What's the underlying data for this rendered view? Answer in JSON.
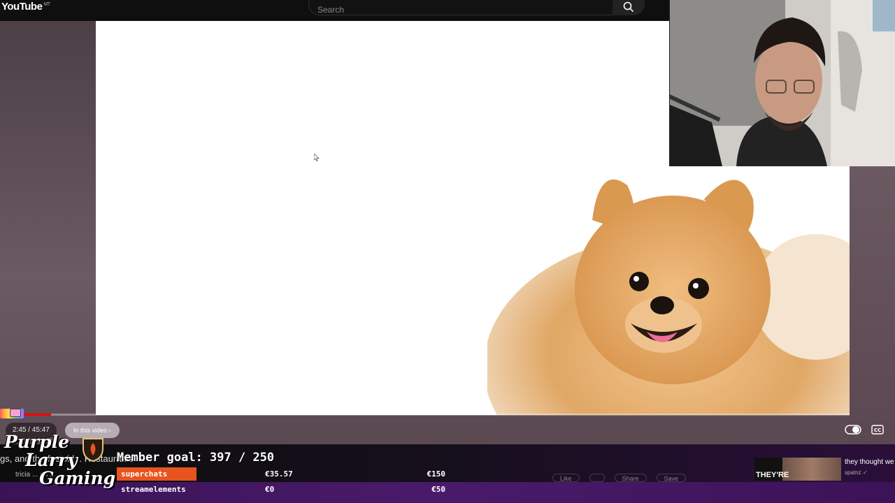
{
  "header": {
    "logo": "YouTube",
    "logo_region": "MT",
    "search_placeholder": "Search"
  },
  "player": {
    "time": "2:45 / 45:47",
    "chapter_label": "In this video",
    "progress": 0.06
  },
  "overlay": {
    "under_text": "gs, and the factoid... Restaurants",
    "under_sub": "tricia ... on ...",
    "logo_lines": [
      "Purple",
      "Larry",
      "Gaming"
    ],
    "member_goal": "Member goal: 397 / 250",
    "donations": [
      {
        "label": "superchats",
        "current": "€35.57",
        "goal": "€150",
        "active": true
      },
      {
        "label": "streamelements",
        "current": "€0",
        "goal": "€50",
        "active": false
      }
    ]
  },
  "actions": [
    "Like",
    "",
    "Share",
    "Save"
  ],
  "recommendation": {
    "thumb_text": "THEY'RE",
    "title": "they thought we",
    "channel": "spatnz"
  },
  "colors": {
    "accent": "#ff0000",
    "superchat_bar": "#e8541e",
    "bottom_purple": "#4a1a6a"
  }
}
